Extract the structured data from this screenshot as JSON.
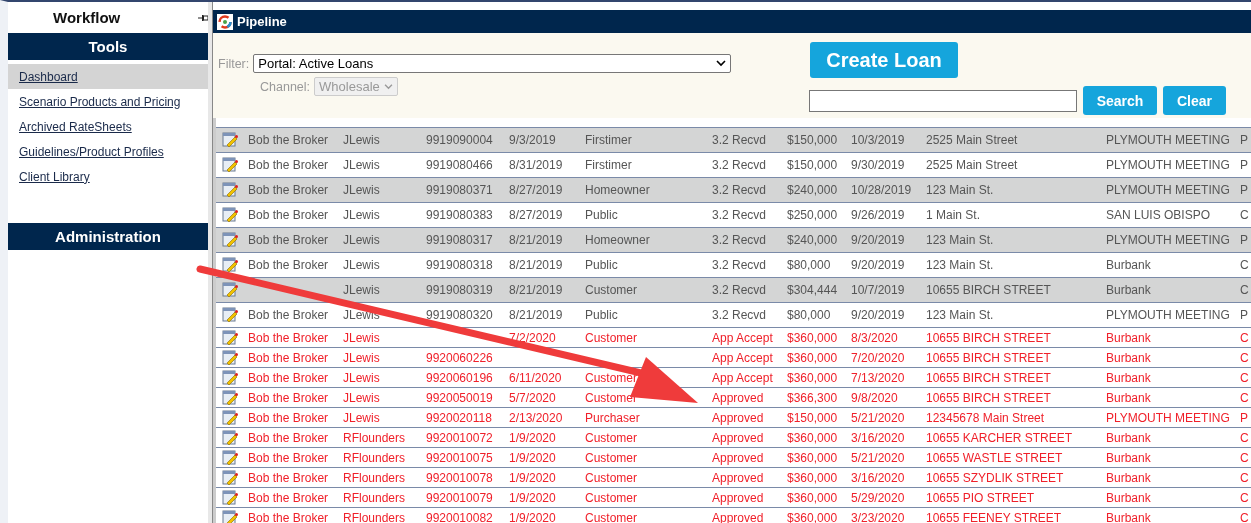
{
  "sidebar": {
    "title": "Workflow",
    "sections": [
      {
        "title": "Tools",
        "items": [
          {
            "label": "Dashboard",
            "selected": true
          },
          {
            "label": "Scenario Products and Pricing",
            "selected": false
          },
          {
            "label": "Archived RateSheets",
            "selected": false
          },
          {
            "label": "Guidelines/Product Profiles",
            "selected": false
          },
          {
            "label": "Client Library",
            "selected": false
          }
        ]
      },
      {
        "title": "Administration"
      }
    ]
  },
  "window": {
    "title": "Pipeline"
  },
  "filter": {
    "label": "Filter:",
    "value": "Portal: Active Loans",
    "channel_label": "Channel:",
    "channel_value": "Wholesale",
    "channel_disabled": true
  },
  "buttons": {
    "create": "Create Loan",
    "search": "Search",
    "clear": "Clear"
  },
  "table": {
    "rows": [
      {
        "alert": false,
        "cells": [
          "Bob the Broker",
          "JLewis",
          "9919090004",
          "9/3/2019",
          "Firstimer",
          "3.2 Recvd",
          "$150,000",
          "10/3/2019",
          "2525 Main Street",
          "PLYMOUTH MEETING",
          "P"
        ]
      },
      {
        "alert": false,
        "cells": [
          "Bob the Broker",
          "JLewis",
          "9919080466",
          "8/31/2019",
          "Firstimer",
          "3.2 Recvd",
          "$150,000",
          "9/30/2019",
          "2525 Main Street",
          "PLYMOUTH MEETING",
          "P"
        ]
      },
      {
        "alert": false,
        "cells": [
          "Bob the Broker",
          "JLewis",
          "9919080371",
          "8/27/2019",
          "Homeowner",
          "3.2 Recvd",
          "$240,000",
          "10/28/2019",
          "123 Main St.",
          "PLYMOUTH MEETING",
          "P"
        ]
      },
      {
        "alert": false,
        "cells": [
          "Bob the Broker",
          "JLewis",
          "9919080383",
          "8/27/2019",
          "Public",
          "3.2 Recvd",
          "$250,000",
          "9/26/2019",
          "1 Main St.",
          "SAN LUIS OBISPO",
          "C"
        ]
      },
      {
        "alert": false,
        "cells": [
          "Bob the Broker",
          "JLewis",
          "9919080317",
          "8/21/2019",
          "Homeowner",
          "3.2 Recvd",
          "$240,000",
          "9/20/2019",
          "123 Main St.",
          "PLYMOUTH MEETING",
          "P"
        ]
      },
      {
        "alert": false,
        "cells": [
          "Bob the Broker",
          "JLewis",
          "9919080318",
          "8/21/2019",
          "Public",
          "3.2 Recvd",
          "$80,000",
          "9/20/2019",
          "123 Main St.",
          "Burbank",
          "C"
        ]
      },
      {
        "alert": false,
        "cells": [
          null,
          "JLewis",
          "9919080319",
          "8/21/2019",
          "Customer",
          "3.2 Recvd",
          "$304,444",
          "10/7/2019",
          "10655 BIRCH STREET",
          "Burbank",
          "C"
        ]
      },
      {
        "alert": false,
        "cells": [
          "Bob the Broker",
          "JLewis",
          "9919080320",
          "8/21/2019",
          "Public",
          "3.2 Recvd",
          "$80,000",
          "9/20/2019",
          "123 Main St.",
          "PLYMOUTH MEETING",
          "P"
        ]
      },
      {
        "alert": true,
        "cells": [
          "Bob the Broker",
          "JLewis",
          null,
          "7/2/2020",
          "Customer",
          "App Accept",
          "$360,000",
          "8/3/2020",
          "10655 BIRCH STREET",
          "Burbank",
          "C"
        ]
      },
      {
        "alert": true,
        "cells": [
          "Bob the Broker",
          "JLewis",
          "9920060226",
          null,
          null,
          "App Accept",
          "$360,000",
          "7/20/2020",
          "10655 BIRCH STREET",
          "Burbank",
          "C"
        ]
      },
      {
        "alert": true,
        "cells": [
          "Bob the Broker",
          "JLewis",
          "9920060196",
          "6/11/2020",
          "Customer",
          "App Accept",
          "$360,000",
          "7/13/2020",
          "10655 BIRCH STREET",
          "Burbank",
          "C"
        ]
      },
      {
        "alert": true,
        "cells": [
          "Bob the Broker",
          "JLewis",
          "9920050019",
          "5/7/2020",
          "Customer",
          "Approved",
          "$366,300",
          "9/8/2020",
          "10655 BIRCH STREET",
          "Burbank",
          "C"
        ]
      },
      {
        "alert": true,
        "cells": [
          "Bob the Broker",
          "JLewis",
          "9920020118",
          "2/13/2020",
          "Purchaser",
          "Approved",
          "$150,000",
          "5/21/2020",
          "12345678 Main Street",
          "PLYMOUTH MEETING",
          "P"
        ]
      },
      {
        "alert": true,
        "cells": [
          "Bob the Broker",
          "RFlounders",
          "9920010072",
          "1/9/2020",
          "Customer",
          "Approved",
          "$360,000",
          "3/16/2020",
          "10655 KARCHER STREET",
          "Burbank",
          "C"
        ]
      },
      {
        "alert": true,
        "cells": [
          "Bob the Broker",
          "RFlounders",
          "9920010075",
          "1/9/2020",
          "Customer",
          "Approved",
          "$360,000",
          "5/21/2020",
          "10655 WASTLE STREET",
          "Burbank",
          "C"
        ]
      },
      {
        "alert": true,
        "cells": [
          "Bob the Broker",
          "RFlounders",
          "9920010078",
          "1/9/2020",
          "Customer",
          "Approved",
          "$360,000",
          "3/16/2020",
          "10655 SZYDLIK STREET",
          "Burbank",
          "C"
        ]
      },
      {
        "alert": true,
        "cells": [
          "Bob the Broker",
          "RFlounders",
          "9920010079",
          "1/9/2020",
          "Customer",
          "Approved",
          "$360,000",
          "5/29/2020",
          "10655 PIO STREET",
          "Burbank",
          "C"
        ]
      },
      {
        "alert": true,
        "cells": [
          "Bob the Broker",
          "RFlounders",
          "9920010082",
          "1/9/2020",
          "Customer",
          "Approved",
          "$360,000",
          "3/23/2020",
          "10655 FEENEY STREET",
          "Burbank",
          "C"
        ]
      }
    ]
  }
}
